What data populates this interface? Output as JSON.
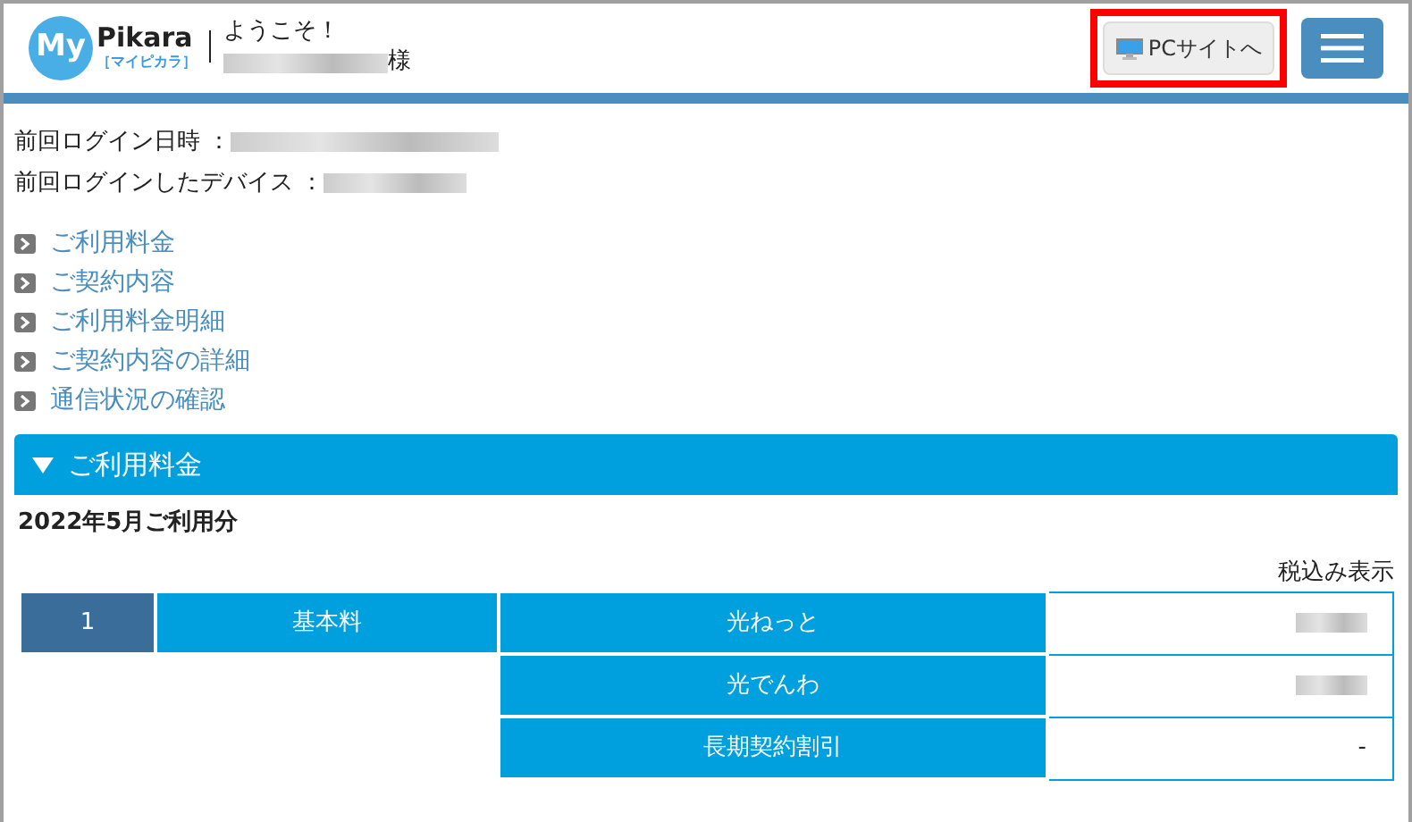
{
  "header": {
    "logo": {
      "word_1": "My",
      "word_2": "Pikara",
      "subtitle": "［マイピカラ］"
    },
    "greeting": "ようこそ！",
    "honorific": "様",
    "name_redacted": true,
    "pc_button": {
      "label": "PCサイトへ",
      "highlighted": true
    }
  },
  "login_info": [
    {
      "label": "前回ログイン日時 ：",
      "redacted": true
    },
    {
      "label": "前回ログインしたデバイス ：",
      "redacted": true
    }
  ],
  "links": [
    "ご利用料金",
    "ご契約内容",
    "ご利用料金明細",
    "ご契約内容の詳細",
    "通信状況の確認"
  ],
  "section": {
    "title": "ご利用料金",
    "expanded": true,
    "period": "2022年5月ご利用分",
    "tax_note": "税込み表示",
    "rows": [
      {
        "number": "1",
        "category": "基本料",
        "item": "光ねっと",
        "redacted": true
      },
      {
        "item": "光でんわ",
        "redacted": true
      },
      {
        "item": "長期契約割引",
        "redacted": false,
        "amount": "-"
      }
    ]
  }
}
